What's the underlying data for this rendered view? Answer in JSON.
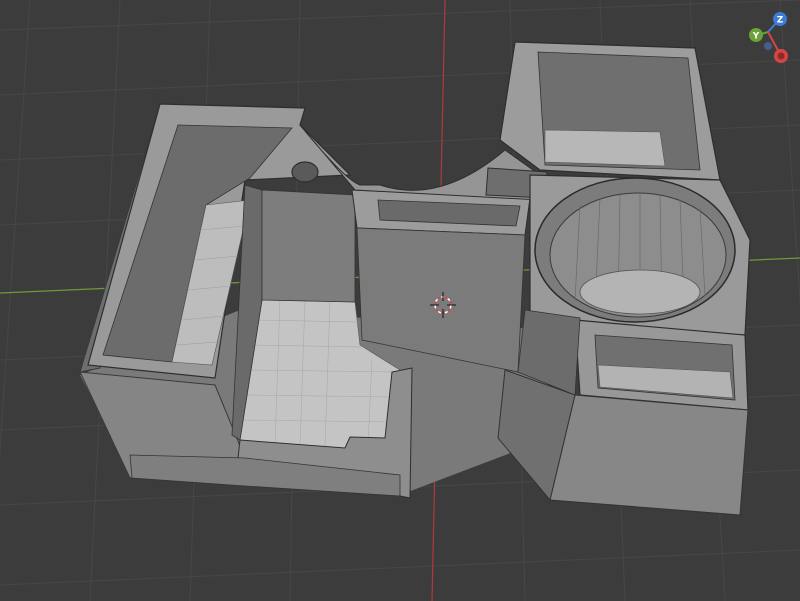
{
  "viewport": {
    "background": "#3c3c3c",
    "grid_color": "#474747",
    "axis_x_color": "#b03a3a",
    "axis_y_color": "#6f9a3a",
    "model_color": "#8a8a8a"
  },
  "gizmo": {
    "z_label": "Z",
    "y_label": "Y",
    "x_label": "",
    "z_color": "#3d7bd6",
    "y_color": "#6aa23a",
    "x_color": "#d64545",
    "icons": [
      "axis-z-icon",
      "axis-y-icon",
      "axis-x-icon"
    ]
  },
  "cursor": {
    "icon": "3d-cursor-icon",
    "colors": [
      "#ffffff",
      "#d64545"
    ]
  }
}
